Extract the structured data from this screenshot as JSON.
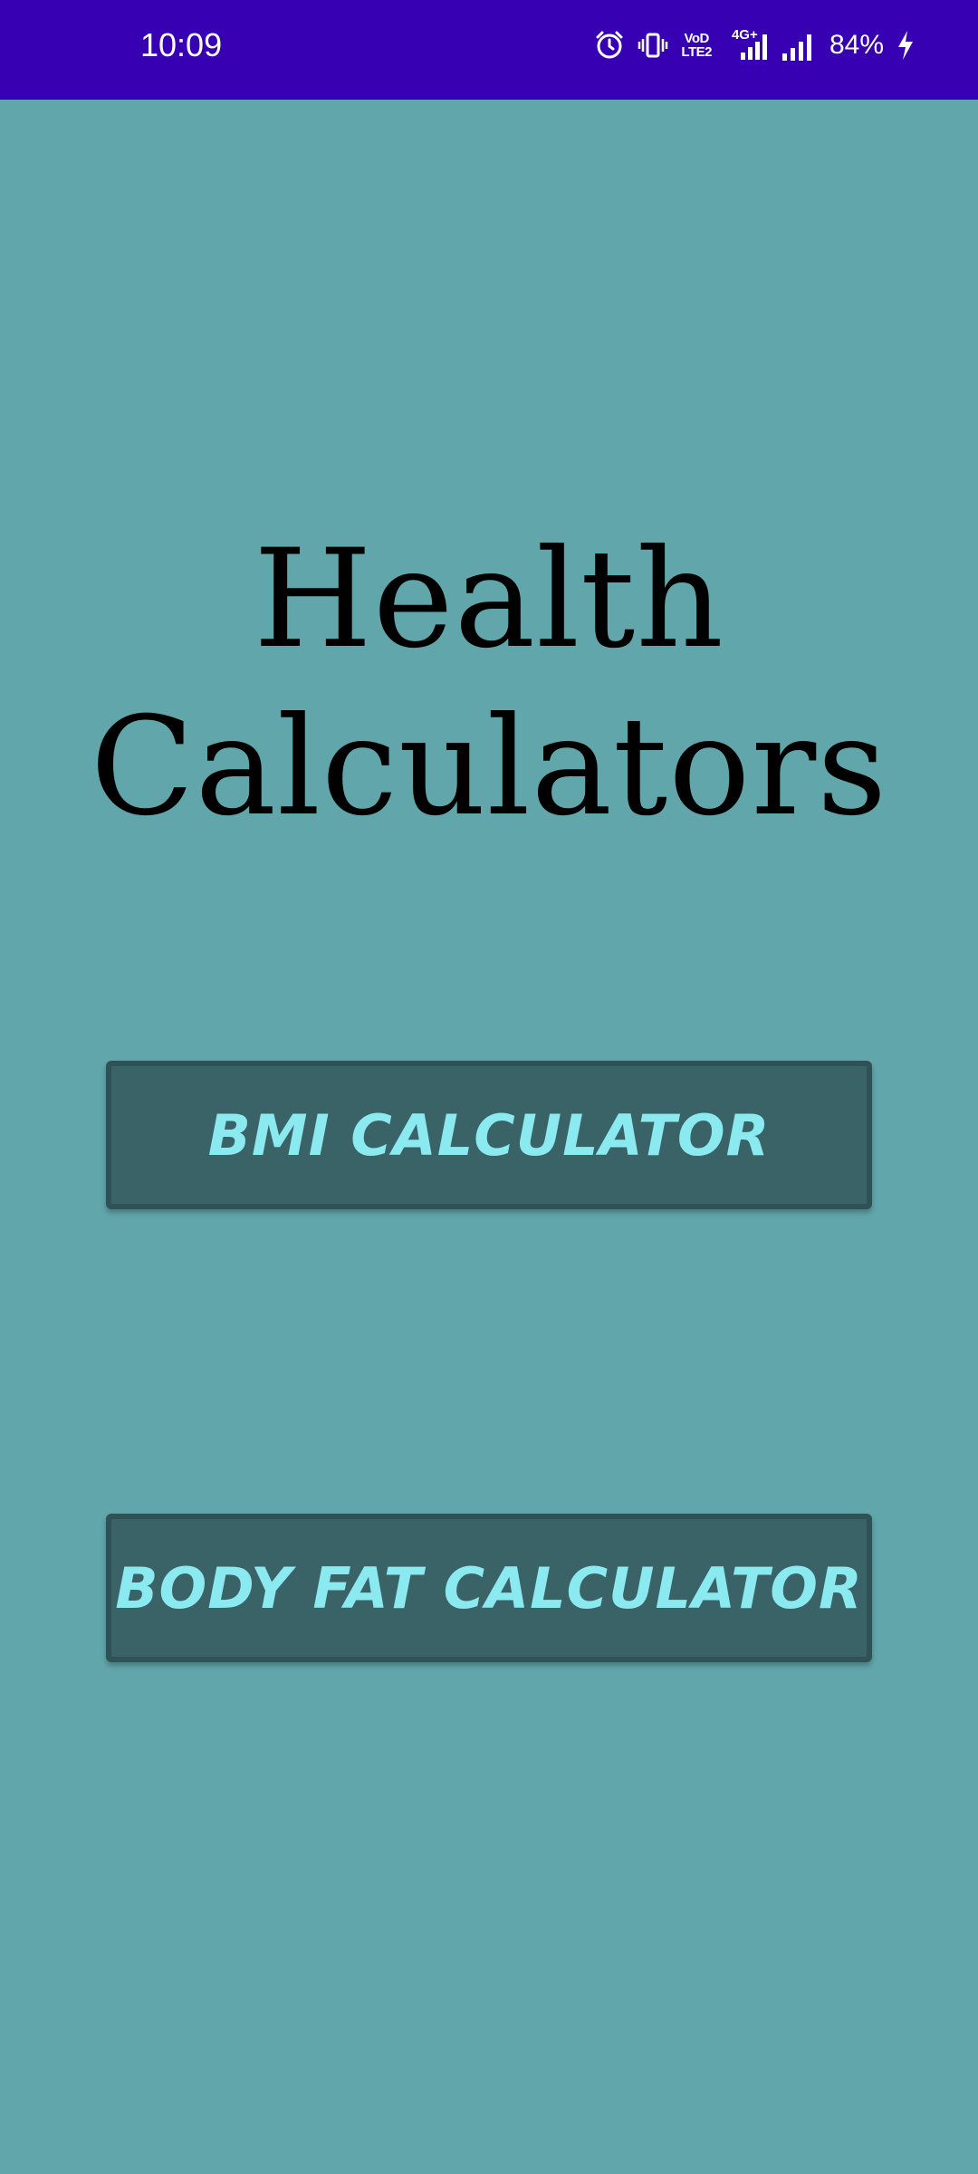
{
  "status_bar": {
    "time": "10:09",
    "battery": "84%",
    "network_label": "4G+",
    "volte_top": "VoD",
    "volte_bottom": "LTE2",
    "icons": [
      "alarm-icon",
      "vibrate-icon",
      "volte-icon",
      "4g-signal-icon",
      "signal-icon",
      "charging-icon"
    ],
    "background": "#3700b3"
  },
  "app": {
    "background": "#61a6ab",
    "title_line1": "Health",
    "title_line2": "Calculators",
    "buttons": {
      "bmi_label": "BMI CALCULATOR",
      "body_fat_label": "BODY FAT CALCULATOR"
    },
    "button_color": "#3a6367",
    "button_text_color": "#8be9f0"
  }
}
